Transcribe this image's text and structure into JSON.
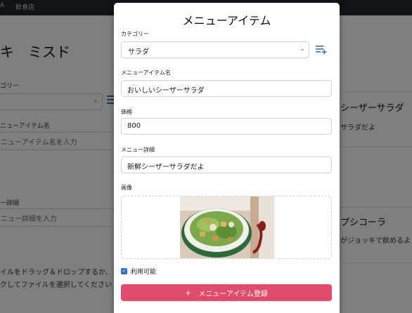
{
  "background": {
    "topbar_left": "A",
    "topbar_shop": "飲食店",
    "page_heading": "キ　ミスド",
    "category_label": "ゴリー",
    "item_name_label": "ニューアイテム名",
    "item_name_placeholder": "ニューアイテム名を入力",
    "detail_label": "ー詳細",
    "detail_placeholder": "ニュー詳細を入力",
    "drop_text_line1": "イルをドラッグ＆ドロップするか、",
    "drop_text_line2": "クしてファイルを選択してください",
    "card1_name": "シーザーサラダ",
    "card1_desc": "サラダだよ",
    "card2_name": "プシコーラ",
    "card2_desc": "がジョッキで飲めるよ"
  },
  "modal": {
    "title": "メニューアイテム",
    "category": {
      "label": "カテゴリー",
      "value": "サラダ"
    },
    "add_category_icon": "playlist-add-icon",
    "item_name": {
      "label": "メニューアイテム名",
      "value": "おいしいシーザーサラダ"
    },
    "price": {
      "label": "価格",
      "value": "800"
    },
    "detail": {
      "label": "メニュー詳細",
      "value": "新鮮シーザーサラダだよ"
    },
    "image": {
      "label": "画像",
      "alt": "caesar-salad-photo"
    },
    "available": {
      "label": "利用可能",
      "checked": true
    },
    "register_button": {
      "icon": "+",
      "label": "メニューアイテム登録"
    }
  },
  "colors": {
    "accent": "#e24c6c",
    "link_blue": "#3b6fb6",
    "checkbox": "#2f6fd6"
  }
}
